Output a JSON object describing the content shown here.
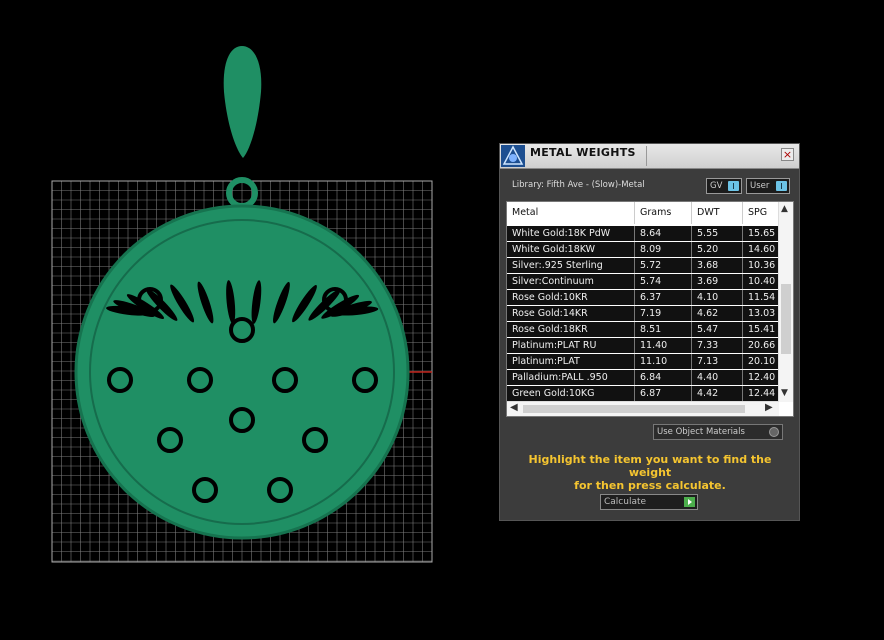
{
  "panel": {
    "title": "METAL WEIGHTS",
    "close_glyph": "×",
    "library_label": "Library: Fifth Ave - (Slow)-Metal",
    "gv_label": "GV",
    "user_label": "User",
    "use_object_materials_label": "Use Object Materials",
    "instructions_line1": "Highlight the item you want to find the weight",
    "instructions_line2": "for then press calculate.",
    "calculate_label": "Calculate"
  },
  "table": {
    "headers": [
      "Metal",
      "Grams",
      "DWT",
      "SPG"
    ],
    "rows": [
      [
        "White Gold:18K PdW",
        "8.64",
        "5.55",
        "15.65"
      ],
      [
        "White Gold:18KW",
        "8.09",
        "5.20",
        "14.60"
      ],
      [
        "Silver:.925 Sterling",
        "5.72",
        "3.68",
        "10.36"
      ],
      [
        "Silver:Continuum",
        "5.74",
        "3.69",
        "10.40"
      ],
      [
        "Rose Gold:10KR",
        "6.37",
        "4.10",
        "11.54"
      ],
      [
        "Rose Gold:14KR",
        "7.19",
        "4.62",
        "13.03"
      ],
      [
        "Rose Gold:18KR",
        "8.51",
        "5.47",
        "15.41"
      ],
      [
        "Platinum:PLAT RU",
        "11.40",
        "7.33",
        "20.66"
      ],
      [
        "Platinum:PLAT",
        "11.10",
        "7.13",
        "20.10"
      ],
      [
        "Palladium:PALL .950",
        "6.84",
        "4.40",
        "12.40"
      ],
      [
        "Green Gold:10KG",
        "6.87",
        "4.42",
        "12.44"
      ]
    ]
  },
  "icons": {
    "app_logo": "rhino-logo-icon",
    "scroll_up": "▲",
    "scroll_down": "▼",
    "scroll_left": "◀",
    "scroll_right": "▶"
  },
  "colors": {
    "model_green": "#1f8f64",
    "instruction_yellow": "#f5c530",
    "grid_line": "#9a9a9a",
    "axis_red": "#c0221a"
  }
}
